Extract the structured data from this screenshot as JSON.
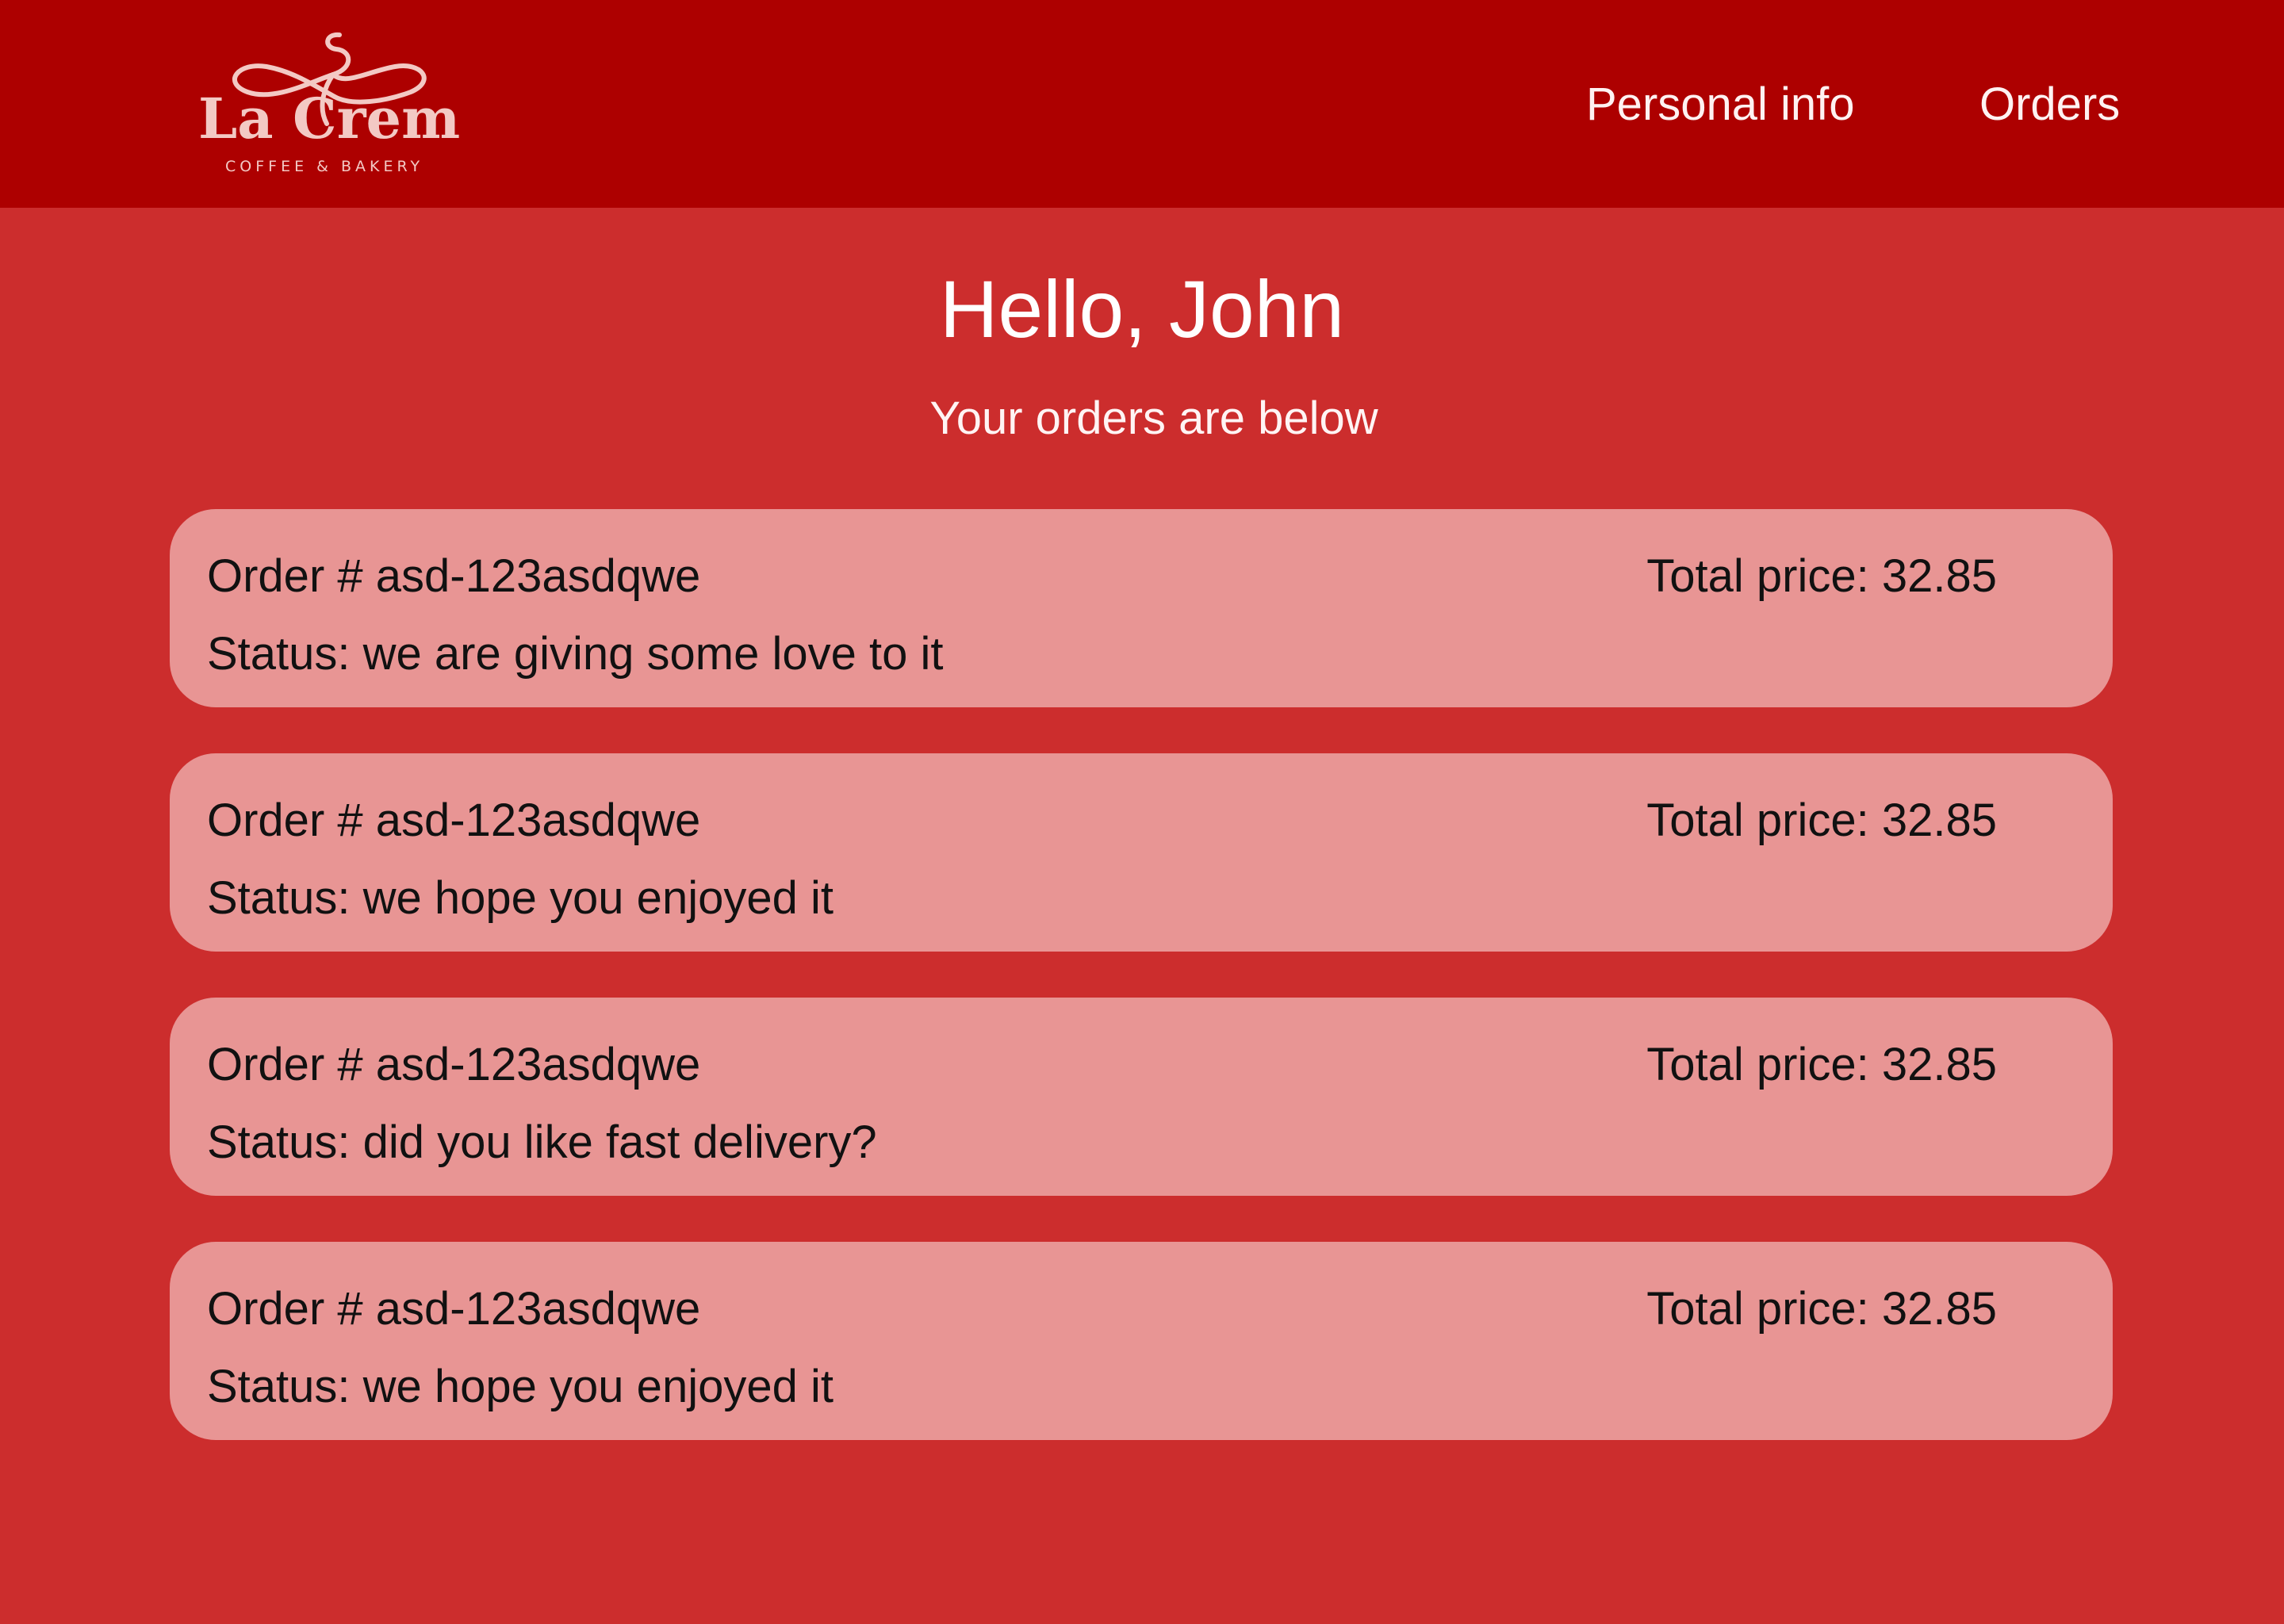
{
  "header": {
    "logo": {
      "name": "La Crema",
      "tagline": "COFFEE & BAKERY"
    },
    "nav": [
      {
        "label": "Personal info"
      },
      {
        "label": "Orders"
      }
    ]
  },
  "main": {
    "greeting": "Hello, John",
    "subtitle": "Your orders are below",
    "orders": [
      {
        "id": "Order # asd-123asdqwe",
        "total": "Total price: 32.85",
        "status": "Status: we are giving some love to it"
      },
      {
        "id": "Order # asd-123asdqwe",
        "total": "Total price: 32.85",
        "status": "Status: we hope you enjoyed it"
      },
      {
        "id": "Order # asd-123asdqwe",
        "total": "Total price: 32.85",
        "status": "Status: did you like fast delivery?"
      },
      {
        "id": "Order # asd-123asdqwe",
        "total": "Total price: 32.85",
        "status": "Status: we hope you enjoyed it"
      }
    ]
  },
  "colors": {
    "header_bg": "#ad0000",
    "page_bg": "#cc2d2d",
    "card_bg": "#e89594",
    "logo": "#f3c9c4"
  }
}
